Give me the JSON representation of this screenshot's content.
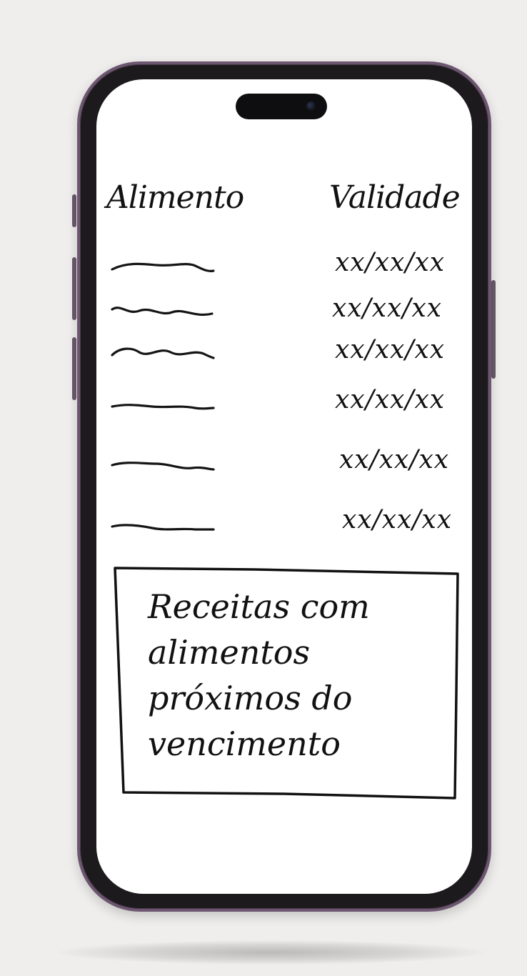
{
  "screen": {
    "columns": {
      "food_header": "Alimento",
      "expiry_header": "Validade"
    },
    "items": [
      {
        "food_icon": "squiggle-placeholder",
        "expiry": "xx/xx/xx"
      },
      {
        "food_icon": "squiggle-placeholder",
        "expiry": "xx/xx/xx"
      },
      {
        "food_icon": "squiggle-placeholder",
        "expiry": "xx/xx/xx"
      },
      {
        "food_icon": "squiggle-placeholder",
        "expiry": "xx/xx/xx"
      },
      {
        "food_icon": "squiggle-placeholder",
        "expiry": "xx/xx/xx"
      },
      {
        "food_icon": "squiggle-placeholder",
        "expiry": "xx/xx/xx"
      }
    ],
    "recipes_button": {
      "label": "Receitas com\nalimentos\npróximos do\nvencimento"
    }
  },
  "colors": {
    "background": "#efeeed",
    "phone_frame": "#6d5670",
    "ink": "#111111",
    "screen": "#ffffff"
  }
}
